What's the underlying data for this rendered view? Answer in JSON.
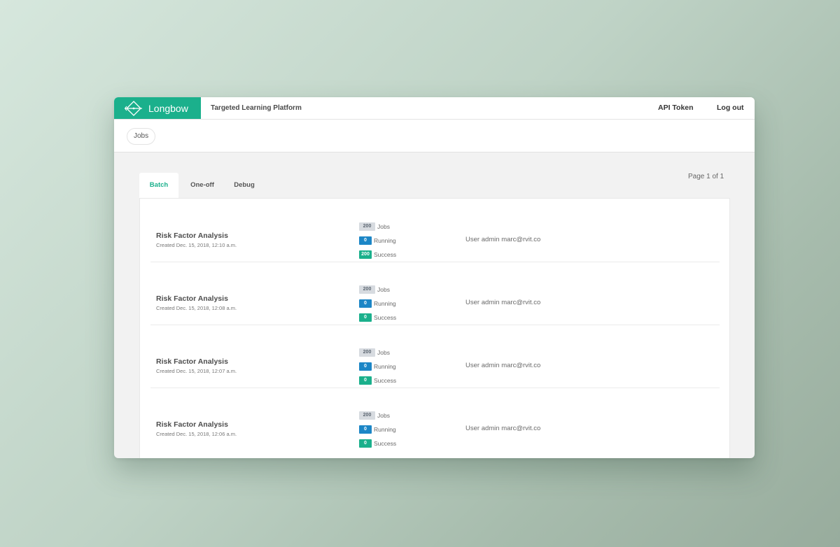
{
  "header": {
    "brand": "Longbow",
    "app_title": "Targeted Learning Platform",
    "api_token": "API Token",
    "logout": "Log out"
  },
  "breadcrumb": {
    "label": "Jobs"
  },
  "tabs": [
    {
      "label": "Batch",
      "active": true
    },
    {
      "label": "One-off",
      "active": false
    },
    {
      "label": "Debug",
      "active": false
    }
  ],
  "pagination": {
    "text": "Page 1 of 1"
  },
  "stat_labels": {
    "jobs": "Jobs",
    "running": "Running",
    "success": "Success"
  },
  "rows": [
    {
      "title": "Risk Factor Analysis",
      "created": "Created Dec. 15, 2018, 12:10 a.m.",
      "jobs": "200",
      "running": "0",
      "success": "200",
      "user": "User admin marc@rvit.co"
    },
    {
      "title": "Risk Factor Analysis",
      "created": "Created Dec. 15, 2018, 12:08 a.m.",
      "jobs": "200",
      "running": "0",
      "success": "0",
      "user": "User admin marc@rvit.co"
    },
    {
      "title": "Risk Factor Analysis",
      "created": "Created Dec. 15, 2018, 12:07 a.m.",
      "jobs": "200",
      "running": "0",
      "success": "0",
      "user": "User admin marc@rvit.co"
    },
    {
      "title": "Risk Factor Analysis",
      "created": "Created Dec. 15, 2018, 12:06 a.m.",
      "jobs": "200",
      "running": "0",
      "success": "0",
      "user": "User admin marc@rvit.co"
    }
  ],
  "colors": {
    "brand": "#1bb08c",
    "running": "#1c86c6",
    "success": "#1bb08c",
    "jobs_badge": "#d7dbe0"
  },
  "icons": {
    "logo": "bow-arrow-icon"
  }
}
